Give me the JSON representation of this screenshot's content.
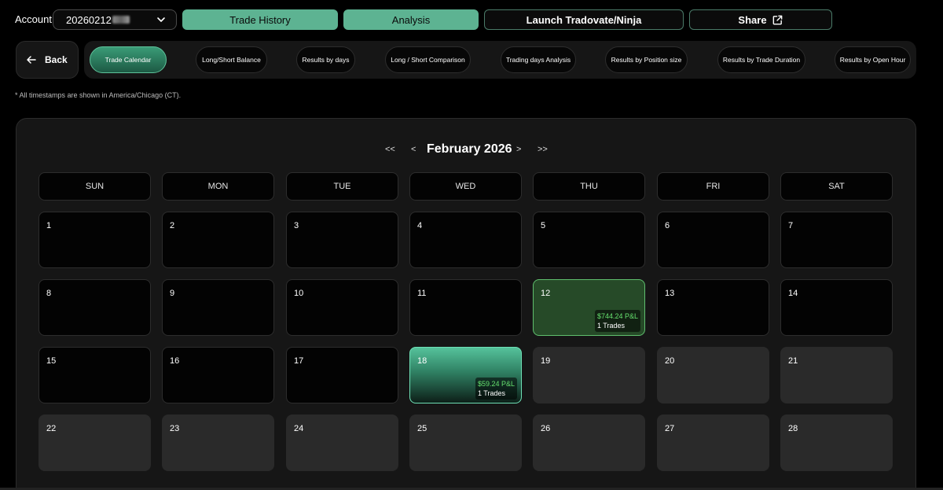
{
  "header": {
    "account_label": "Account",
    "account_value": "20260212",
    "trade_history_label": "Trade History",
    "analysis_label": "Analysis",
    "launch_label": "Launch Tradovate/Ninja",
    "share_label": "Share"
  },
  "nav": {
    "back_label": "Back",
    "tabs": [
      {
        "label": "Trade Calendar",
        "active": true
      },
      {
        "label": "Long/Short Balance",
        "active": false
      },
      {
        "label": "Results by days",
        "active": false
      },
      {
        "label": "Long / Short Comparison",
        "active": false
      },
      {
        "label": "Trading days Analysis",
        "active": false
      },
      {
        "label": "Results by Position size",
        "active": false
      },
      {
        "label": "Results by Trade Duration",
        "active": false
      },
      {
        "label": "Results by Open Hour",
        "active": false
      }
    ]
  },
  "timezone_note": "* All timestamps are shown in America/Chicago (CT).",
  "calendar": {
    "month_title": "February 2026",
    "prev_year": "<<",
    "prev_month": "<",
    "next_month": ">",
    "next_year": ">>",
    "weekdays": [
      "SUN",
      "MON",
      "TUE",
      "WED",
      "THU",
      "FRI",
      "SAT"
    ],
    "days": [
      {
        "n": "1"
      },
      {
        "n": "2"
      },
      {
        "n": "3"
      },
      {
        "n": "4"
      },
      {
        "n": "5"
      },
      {
        "n": "6"
      },
      {
        "n": "7"
      },
      {
        "n": "8"
      },
      {
        "n": "9"
      },
      {
        "n": "10"
      },
      {
        "n": "11"
      },
      {
        "n": "12",
        "state": "win",
        "pnl": "$744.24 P&L",
        "trades": "1 Trades"
      },
      {
        "n": "13"
      },
      {
        "n": "14"
      },
      {
        "n": "15"
      },
      {
        "n": "16"
      },
      {
        "n": "17"
      },
      {
        "n": "18",
        "state": "today",
        "pnl": "$59.24 P&L",
        "trades": "1 Trades"
      },
      {
        "n": "19",
        "state": "future"
      },
      {
        "n": "20",
        "state": "future"
      },
      {
        "n": "21",
        "state": "future"
      },
      {
        "n": "22",
        "state": "future"
      },
      {
        "n": "23",
        "state": "future"
      },
      {
        "n": "24",
        "state": "future"
      },
      {
        "n": "25",
        "state": "future"
      },
      {
        "n": "26",
        "state": "future"
      },
      {
        "n": "27",
        "state": "future"
      },
      {
        "n": "28",
        "state": "future"
      }
    ]
  },
  "colors": {
    "accent": "#5db392",
    "profit_text": "#66e06e",
    "win_cell": "#264a28",
    "future_cell": "#2a2a2a"
  }
}
